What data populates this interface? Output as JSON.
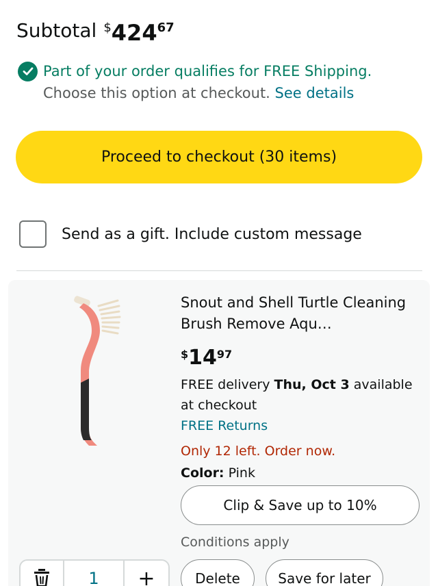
{
  "subtotal": {
    "label": "Subtotal",
    "currency": "$",
    "whole": "424",
    "fraction": "67"
  },
  "shipping": {
    "message": "Part of your order qualifies for FREE Shipping.",
    "note": "Choose this option at checkout.",
    "link": "See details"
  },
  "checkout": {
    "label": "Proceed to checkout (30 items)"
  },
  "gift": {
    "label": "Send as a gift. Include custom message",
    "checked": false
  },
  "item": {
    "title": "Snout and Shell Turtle Cleaning Brush Remove Aqu…",
    "price": {
      "currency": "$",
      "whole": "14",
      "fraction": "97"
    },
    "delivery_prefix": "FREE delivery",
    "delivery_date": "Thu, Oct 3",
    "delivery_suffix": "available at checkout",
    "returns": "FREE Returns",
    "stock": "Only 12 left. Order now.",
    "color_label": "Color:",
    "color_value": "Pink",
    "clip_label": "Clip & Save up to 10%",
    "conditions": "Conditions apply",
    "quantity": "1",
    "plus": "+",
    "delete_label": "Delete",
    "save_label": "Save for later"
  },
  "colors": {
    "accent_yellow": "#ffd814",
    "green": "#067d62",
    "link": "#007185",
    "stock_red": "#b12704",
    "product_pink": "#f08a7e"
  },
  "icons": [
    "check-circle-icon",
    "trash-icon",
    "plus-icon"
  ]
}
